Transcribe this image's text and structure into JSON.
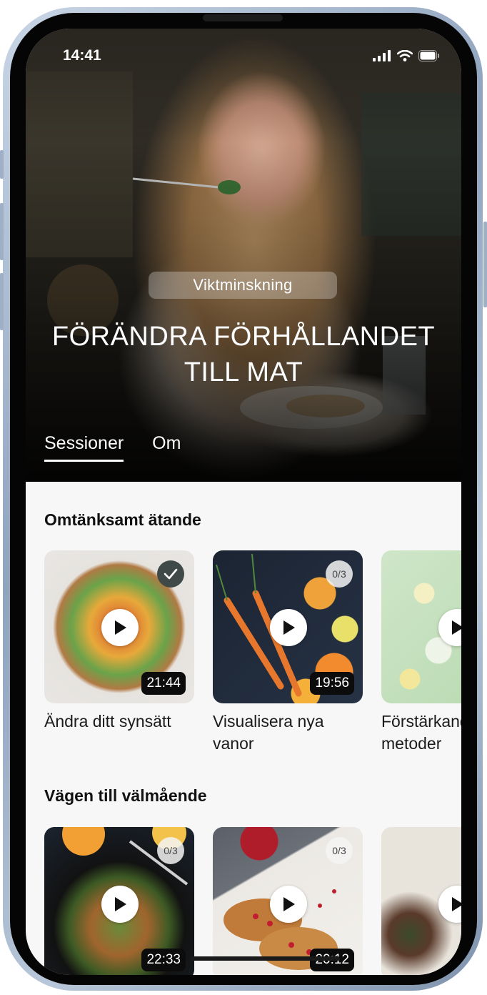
{
  "status_bar": {
    "time": "14:41"
  },
  "hero": {
    "category": "Viktminskning",
    "title_line1": "FÖRÄNDRA FÖRHÅLLANDET",
    "title_line2": "TILL MAT"
  },
  "tabs": [
    {
      "label": "Sessioner",
      "active": true
    },
    {
      "label": "Om",
      "active": false
    }
  ],
  "sections": [
    {
      "title": "Omtänksamt ätande",
      "cards": [
        {
          "label": "Ändra ditt synsätt",
          "duration": "21:44",
          "completed": true,
          "icon": "check-icon"
        },
        {
          "label": "Visualisera nya vanor",
          "duration": "19:56",
          "progress": "0/3"
        },
        {
          "label": "Förstärkande metoder",
          "progress": ""
        }
      ]
    },
    {
      "title": "Vägen till välmående",
      "cards": [
        {
          "duration": "22:33",
          "progress": "0/3"
        },
        {
          "duration": "20:12",
          "progress": "0/3"
        },
        {
          "progress": ""
        }
      ]
    }
  ],
  "colors": {
    "accent_dark": "#3f4a48",
    "background": "#f6f7f6",
    "text": "#111111"
  }
}
